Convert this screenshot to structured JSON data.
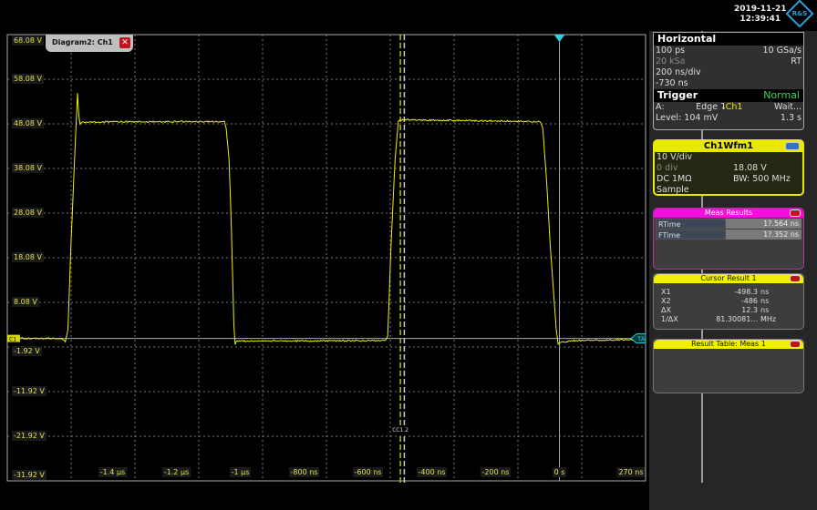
{
  "clock": {
    "date": "2019-11-21",
    "time": "12:39:41"
  },
  "logo": "R&S",
  "diagram_tab": {
    "label": "Diagram2: Ch1"
  },
  "horizontal": {
    "title": "Horizontal",
    "resolution": "100 ps",
    "sample_rate": "10 GSa/s",
    "record_length": "20 kSa",
    "mode": "RT",
    "time_scale": "200 ns/div",
    "position": "-730 ns"
  },
  "trigger": {
    "title": "Trigger",
    "mode": "Normal",
    "source_label": "A:",
    "type": "Edge",
    "channel": "Ch1",
    "state": "Wait...",
    "level": "Level: 104 mV",
    "time": "1.3 s"
  },
  "channel": {
    "title": "Ch1Wfm1",
    "scale": "10 V/div",
    "offset_div": "0 div",
    "offset": "18.08 V",
    "coupling": "DC 1MΩ",
    "bandwidth": "BW: 500 MHz",
    "acq": "Sample"
  },
  "meas_results": {
    "title": "Meas Results",
    "rows": [
      {
        "name": "RTime",
        "value": "1?.564 ns"
      },
      {
        "name": "FTime",
        "value": "1?.352 ns"
      }
    ]
  },
  "cursor_result": {
    "title": "Cursor Result 1",
    "rows": [
      {
        "name": "X1",
        "value": "-498.3",
        "unit": "ns"
      },
      {
        "name": "X2",
        "value": "-486",
        "unit": "ns"
      },
      {
        "name": "ΔX",
        "value": "12.3",
        "unit": "ns"
      },
      {
        "name": "1/ΔX",
        "value": "81.30081...",
        "unit": "MHz"
      }
    ]
  },
  "result_table": {
    "title": "Result Table: Meas 1"
  },
  "cursor_label": "CC1.2",
  "ground_marker": "C1",
  "trigger_marker": "TA",
  "colors": {
    "trace": "#f0f000",
    "grid": "#8a8a8a",
    "meas": "#f010e0",
    "trigger": "#30d0e0"
  },
  "chart_data": {
    "type": "line",
    "xlabel": "time",
    "ylabel": "voltage",
    "xlim": [
      -1730,
      270
    ],
    "ylim": [
      -31.92,
      68.08
    ],
    "y_ticks": [
      "68.08 V",
      "58.08 V",
      "48.08 V",
      "38.08 V",
      "28.08 V",
      "18.08 V",
      "8.08 V",
      "-1.92 V",
      "-11.92 V",
      "-21.92 V",
      "-31.92 V"
    ],
    "y_tick_values": [
      68.08,
      58.08,
      48.08,
      38.08,
      28.08,
      18.08,
      8.08,
      -1.92,
      -11.92,
      -21.92,
      -31.92
    ],
    "x_ticks": [
      "-1.4 µs",
      "-1.2 µs",
      "-1 µs",
      "-800 ns",
      "-600 ns",
      "-400 ns",
      "-200 ns",
      "0 s",
      "270 ns"
    ],
    "x_tick_values": [
      -1400,
      -1200,
      -1000,
      -800,
      -600,
      -400,
      -200,
      0,
      270
    ],
    "cursors": [
      -498.3,
      -486
    ],
    "series": [
      {
        "name": "Ch1Wfm1",
        "x": [
          -1730,
          -1560,
          -1548,
          -1540,
          -1530,
          -1518,
          -1510,
          -1506,
          -1502,
          -1496,
          -1050,
          -1044,
          -1035,
          -1028,
          -1020,
          -1016,
          -1012,
          -545,
          -538,
          -528,
          -515,
          -505,
          -500,
          -60,
          -52,
          -40,
          -28,
          -10,
          -4,
          0,
          40,
          270
        ],
        "y": [
          0,
          0,
          -0.8,
          2,
          22,
          42,
          55,
          50,
          48,
          48.5,
          48.6,
          47,
          40,
          25,
          3,
          -1.2,
          -0.6,
          -0.5,
          0.5,
          20,
          40,
          48.5,
          49,
          48.6,
          47,
          35,
          20,
          2,
          -1.3,
          -1,
          -0.5,
          -0.2
        ]
      }
    ]
  }
}
